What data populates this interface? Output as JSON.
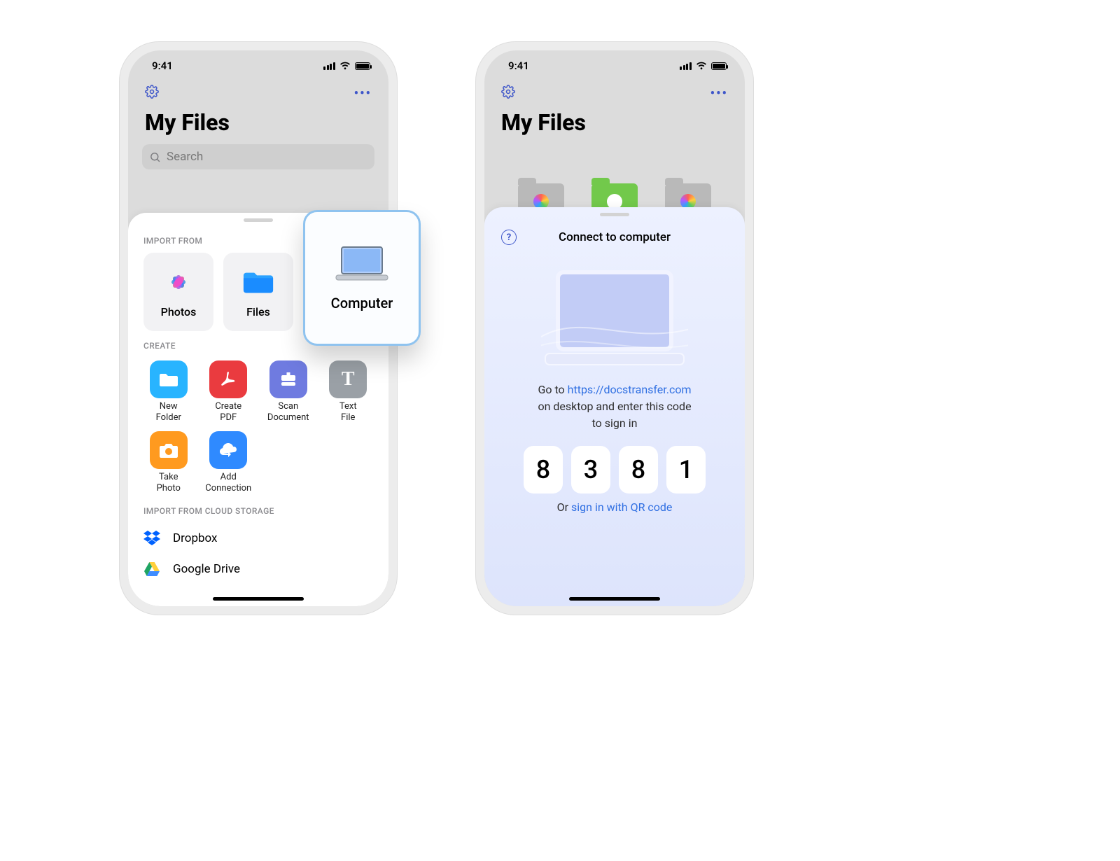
{
  "status_time": "9:41",
  "page_title": "My Files",
  "search_placeholder": "Search",
  "sections": {
    "import": "IMPORT FROM",
    "create": "CREATE",
    "cloud": "IMPORT FROM CLOUD STORAGE"
  },
  "import_cards": {
    "photos": "Photos",
    "files": "Files",
    "computer": "Computer"
  },
  "create_items": {
    "new_folder": "New\nFolder",
    "create_pdf": "Create\nPDF",
    "scan_doc": "Scan\nDocument",
    "text_file": "Text\nFile",
    "take_photo": "Take\nPhoto",
    "add_conn": "Add\nConnection"
  },
  "cloud": {
    "dropbox": "Dropbox",
    "gdrive": "Google Drive"
  },
  "float_card_label": "Computer",
  "connect": {
    "title": "Connect to computer",
    "desc_prefix": "Go to ",
    "desc_link": "https://docstransfer.com",
    "desc_suffix1": "on desktop and enter this code",
    "desc_suffix2": "to sign in",
    "code": [
      "8",
      "3",
      "8",
      "1"
    ],
    "or_prefix": "Or ",
    "or_link": "sign in with QR code"
  }
}
